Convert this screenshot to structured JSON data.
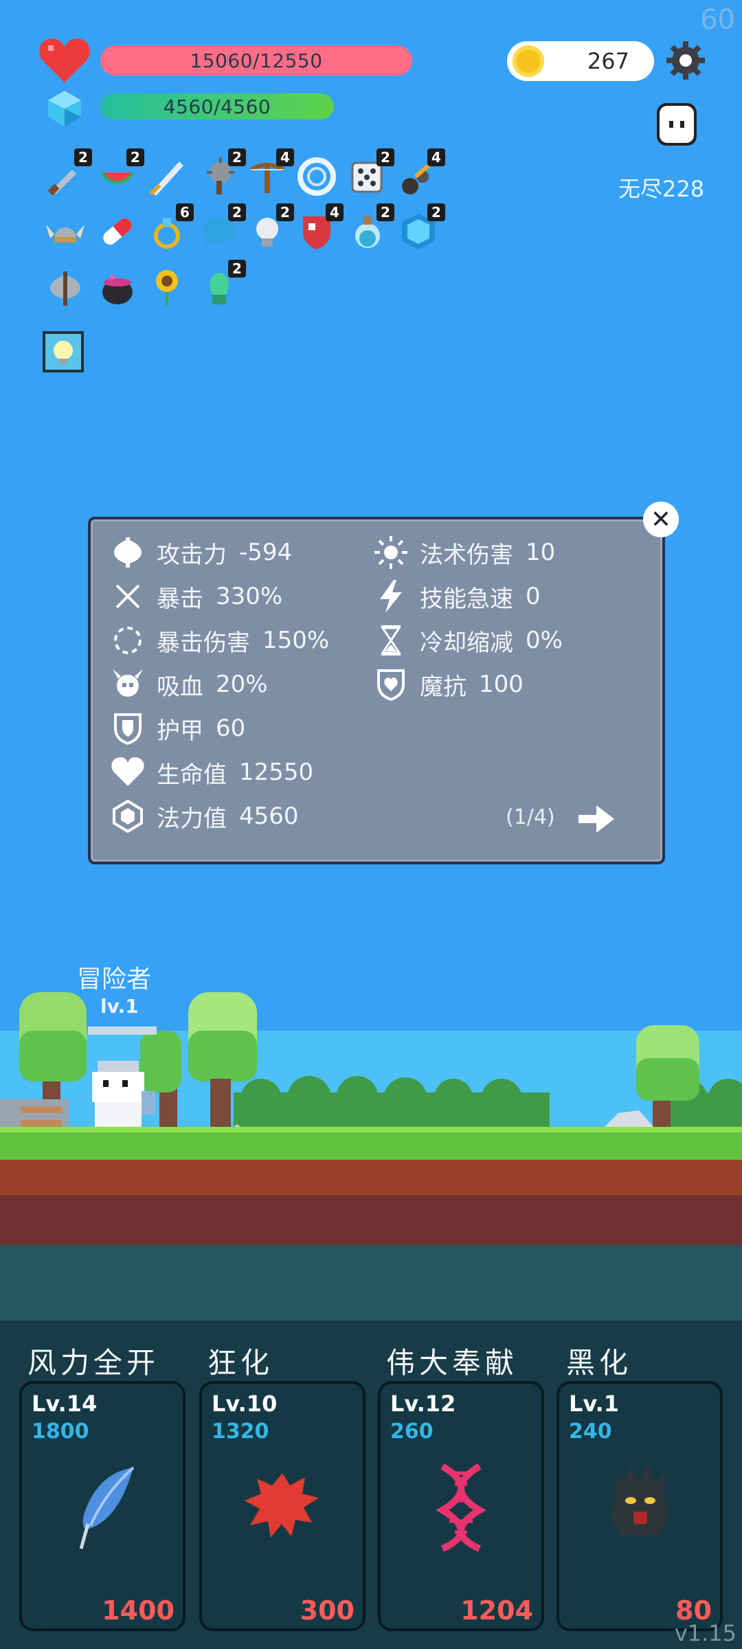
{
  "fps": "60",
  "version": "v1.15",
  "hud": {
    "hp_text": "15060/12550",
    "mp_text": "4560/4560",
    "coins": "267",
    "endless_label": "无尽228"
  },
  "items": {
    "row1": [
      {
        "icon": "dagger-icon",
        "badge": "2"
      },
      {
        "icon": "watermelon-icon",
        "badge": "2"
      },
      {
        "icon": "sword-icon",
        "badge": ""
      },
      {
        "icon": "spiked-club-icon",
        "badge": "2"
      },
      {
        "icon": "crossbow-icon",
        "badge": "4"
      },
      {
        "icon": "target-ring-icon",
        "badge": ""
      },
      {
        "icon": "dice-icon",
        "badge": "2"
      },
      {
        "icon": "meteor-icon",
        "badge": "4"
      }
    ],
    "row2": [
      {
        "icon": "viking-helmet-icon",
        "badge": ""
      },
      {
        "icon": "pill-icon",
        "badge": ""
      },
      {
        "icon": "ring-icon",
        "badge": "6"
      },
      {
        "icon": "speech-bubble-icon",
        "badge": "2"
      },
      {
        "icon": "lightbulb-icon",
        "badge": "2"
      },
      {
        "icon": "shield-icon",
        "badge": "4"
      },
      {
        "icon": "potion-icon",
        "badge": "2"
      },
      {
        "icon": "blue-gem-icon",
        "badge": "2"
      }
    ],
    "row3": [
      {
        "icon": "battle-axe-icon",
        "badge": ""
      },
      {
        "icon": "cauldron-icon",
        "badge": ""
      },
      {
        "icon": "sunflower-icon",
        "badge": ""
      },
      {
        "icon": "green-spirit-icon",
        "badge": "2"
      }
    ],
    "row4": [
      {
        "icon": "glowing-bulb-tile-icon",
        "badge": ""
      }
    ]
  },
  "stats": {
    "left": [
      {
        "icon": "axe-icon",
        "label": "攻击力",
        "value": "-594"
      },
      {
        "icon": "crit-cross-icon",
        "label": "暴击",
        "value": "330%"
      },
      {
        "icon": "crit-ring-icon",
        "label": "暴击伤害",
        "value": "150%"
      },
      {
        "icon": "horned-skull-icon",
        "label": "吸血",
        "value": "20%"
      },
      {
        "icon": "armor-shield-icon",
        "label": "护甲",
        "value": "60"
      },
      {
        "icon": "heart-icon",
        "label": "生命值",
        "value": "12550"
      },
      {
        "icon": "mana-crystal-icon",
        "label": "法力值",
        "value": "4560"
      }
    ],
    "right": [
      {
        "icon": "sun-icon",
        "label": "法术伤害",
        "value": "10"
      },
      {
        "icon": "lightning-icon",
        "label": "技能急速",
        "value": "0"
      },
      {
        "icon": "hourglass-icon",
        "label": "冷却缩减",
        "value": "0%"
      },
      {
        "icon": "heart-shield-icon",
        "label": "魔抗",
        "value": "100"
      }
    ],
    "page": "(1/4)"
  },
  "character": {
    "name": "冒险者",
    "level": "lv.1"
  },
  "skills": [
    {
      "title": "风力全开",
      "level": "Lv.14",
      "cost": "1800",
      "value": "1400",
      "icon": "feather-icon"
    },
    {
      "title": "狂化",
      "level": "Lv.10",
      "cost": "1320",
      "value": "300",
      "icon": "red-splat-icon"
    },
    {
      "title": "伟大奉献",
      "level": "Lv.12",
      "cost": "260",
      "value": "1204",
      "icon": "dna-icon"
    },
    {
      "title": "黑化",
      "level": "Lv.1",
      "cost": "240",
      "value": "80",
      "icon": "dark-tree-icon"
    }
  ]
}
